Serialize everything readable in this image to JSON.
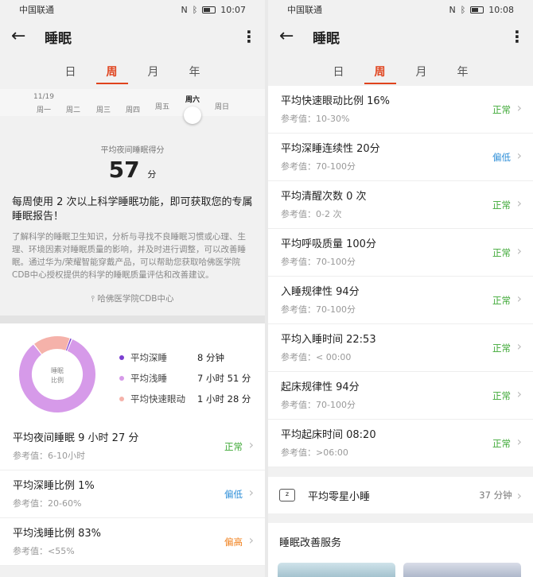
{
  "status": {
    "left_carrier": "中国联通",
    "left_time": "10:07",
    "right_carrier": "中国联通",
    "right_time": "10:08"
  },
  "appbar": {
    "title": "睡眠"
  },
  "tabs": [
    {
      "label": "日"
    },
    {
      "label": "周"
    },
    {
      "label": "月"
    },
    {
      "label": "年"
    }
  ],
  "week": {
    "date": "11/19",
    "days": [
      "周一",
      "周二",
      "周三",
      "周四",
      "周五",
      "周六",
      "周日"
    ],
    "selected": "周六"
  },
  "score": {
    "label": "平均夜间睡眠得分",
    "value": "57",
    "unit": "分"
  },
  "promo": {
    "headline": "每周使用 2 次以上科学睡眠功能，即可获取您的专属睡眠报告！",
    "body": "了解科学的睡眠卫生知识，分析与寻找不良睡眠习惯或心理、生理、环境因素对睡眠质量的影响，并及时进行调整，可以改善睡眠。通过华为/荣耀智能穿戴产品，可以帮助您获取哈佛医学院CDB中心授权提供的科学的睡眠质量评估和改善建议。",
    "source": "哈佛医学院CDB中心"
  },
  "donut": {
    "center_line1": "睡眠",
    "center_line2": "比例",
    "slices": [
      {
        "name": "平均深睡",
        "value_text": "8 分钟",
        "fraction": 0.01,
        "color": "#7b3fd1"
      },
      {
        "name": "平均浅睡",
        "value_text": "7 小时 51 分",
        "fraction": 0.83,
        "color": "#d69ae9"
      },
      {
        "name": "平均快速眼动",
        "value_text": "1 小时 28 分",
        "fraction": 0.16,
        "color": "#f5b2aa"
      }
    ]
  },
  "left_metrics": [
    {
      "title": "平均夜间睡眠  9 小时 27 分",
      "ref": "参考值：6-10小时",
      "status": "正常",
      "level": "normal"
    },
    {
      "title": "平均深睡比例  1%",
      "ref": "参考值：20-60%",
      "status": "偏低",
      "level": "low"
    },
    {
      "title": "平均浅睡比例  83%",
      "ref": "参考值：<55%",
      "status": "偏高",
      "level": "high"
    }
  ],
  "right_metrics": [
    {
      "title": "平均快速眼动比例  16%",
      "ref": "参考值：10-30%",
      "status": "正常",
      "level": "normal"
    },
    {
      "title": "平均深睡连续性  20分",
      "ref": "参考值：70-100分",
      "status": "偏低",
      "level": "low"
    },
    {
      "title": "平均清醒次数  0 次",
      "ref": "参考值：0-2 次",
      "status": "正常",
      "level": "normal"
    },
    {
      "title": "平均呼吸质量  100分",
      "ref": "参考值：70-100分",
      "status": "正常",
      "level": "normal"
    },
    {
      "title": "入睡规律性  94分",
      "ref": "参考值：70-100分",
      "status": "正常",
      "level": "normal"
    },
    {
      "title": "平均入睡时间  22:53",
      "ref": "参考值：< 00:00",
      "status": "正常",
      "level": "normal"
    },
    {
      "title": "起床规律性  94分",
      "ref": "参考值：70-100分",
      "status": "正常",
      "level": "normal"
    },
    {
      "title": "平均起床时间  08:20",
      "ref": "参考值：>06:00",
      "status": "正常",
      "level": "normal"
    }
  ],
  "nap": {
    "label": "平均零星小睡",
    "value": "37 分钟"
  },
  "services": {
    "title": "睡眠改善服务"
  },
  "colors": {
    "accent": "#e0431d",
    "normal": "#3da835",
    "low": "#2f8fd8",
    "high": "#f07f1a"
  }
}
